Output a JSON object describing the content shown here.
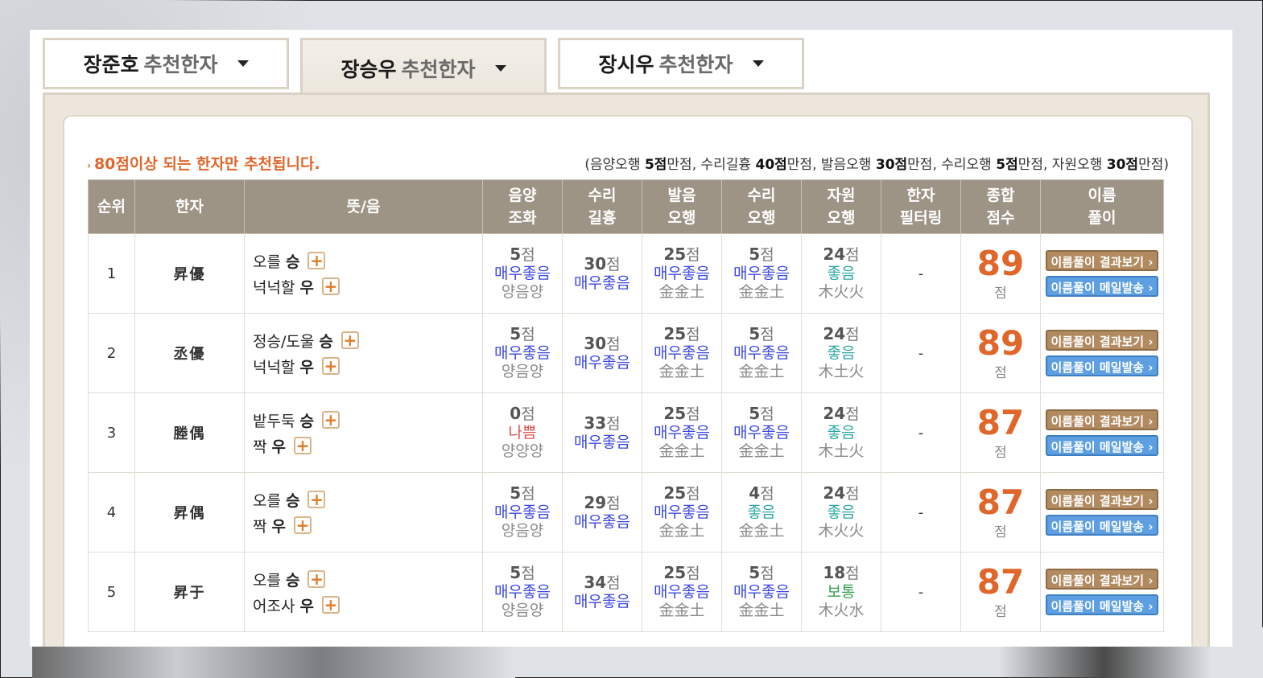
{
  "tabs": [
    {
      "name": "장준호",
      "suffix": "추천한자",
      "active": false
    },
    {
      "name": "장승우",
      "suffix": "추천한자",
      "active": true
    },
    {
      "name": "장시우",
      "suffix": "추천한자",
      "active": false
    }
  ],
  "notice": "80점이상 되는 한자만 추천됩니다.",
  "scoring": {
    "p1": "(음양오행 ",
    "v1": "5점",
    "p2": "만점, 수리길흉 ",
    "v2": "40점",
    "p3": "만점, 발음오행 ",
    "v3": "30점",
    "p4": "만점, 수리오행 ",
    "v4": "5점",
    "p5": "만점, 자원오행 ",
    "v5": "30점",
    "p6": "만점)"
  },
  "headers": {
    "rank": "순위",
    "hanja": "한자",
    "meaning": "뜻/음",
    "yinyang": [
      "음양",
      "조화"
    ],
    "suri": [
      "수리",
      "길흉"
    ],
    "pron": [
      "발음",
      "오행"
    ],
    "surielem": [
      "수리",
      "오행"
    ],
    "source": [
      "자원",
      "오행"
    ],
    "filter": [
      "한자",
      "필터링"
    ],
    "total": [
      "종합",
      "점수"
    ],
    "interp": [
      "이름",
      "풀이"
    ]
  },
  "unit": "점",
  "buttons": {
    "result": "이름풀이 결과보기",
    "mail": "이름풀이 메일발송"
  },
  "rows": [
    {
      "rank": "1",
      "hanja": "昇優",
      "m1": {
        "meaning": "오를",
        "sound": "승"
      },
      "m2": {
        "meaning": "넉넉할",
        "sound": "우"
      },
      "yy": {
        "score": "5",
        "grade": "매우좋음",
        "detail": "양음양"
      },
      "suri": {
        "score": "30",
        "grade": "매우좋음"
      },
      "pron": {
        "score": "25",
        "grade": "매우좋음",
        "detail": "金金土"
      },
      "se": {
        "score": "5",
        "grade": "매우좋음",
        "detail": "金金土"
      },
      "src": {
        "score": "24",
        "grade": "좋음",
        "detail": "木火火"
      },
      "filter": "-",
      "total": "89"
    },
    {
      "rank": "2",
      "hanja": "丞優",
      "m1": {
        "meaning": "정승/도울",
        "sound": "승"
      },
      "m2": {
        "meaning": "넉넉할",
        "sound": "우"
      },
      "yy": {
        "score": "5",
        "grade": "매우좋음",
        "detail": "양음양"
      },
      "suri": {
        "score": "30",
        "grade": "매우좋음"
      },
      "pron": {
        "score": "25",
        "grade": "매우좋음",
        "detail": "金金土"
      },
      "se": {
        "score": "5",
        "grade": "매우좋음",
        "detail": "金金土"
      },
      "src": {
        "score": "24",
        "grade": "좋음",
        "detail": "木土火"
      },
      "filter": "-",
      "total": "89"
    },
    {
      "rank": "3",
      "hanja": "塍偶",
      "m1": {
        "meaning": "밭두둑",
        "sound": "승"
      },
      "m2": {
        "meaning": "짝",
        "sound": "우"
      },
      "yy": {
        "score": "0",
        "grade": "나쁨",
        "detail": "양양양"
      },
      "suri": {
        "score": "33",
        "grade": "매우좋음"
      },
      "pron": {
        "score": "25",
        "grade": "매우좋음",
        "detail": "金金土"
      },
      "se": {
        "score": "5",
        "grade": "매우좋음",
        "detail": "金金土"
      },
      "src": {
        "score": "24",
        "grade": "좋음",
        "detail": "木土火"
      },
      "filter": "-",
      "total": "87"
    },
    {
      "rank": "4",
      "hanja": "昇偶",
      "m1": {
        "meaning": "오를",
        "sound": "승"
      },
      "m2": {
        "meaning": "짝",
        "sound": "우"
      },
      "yy": {
        "score": "5",
        "grade": "매우좋음",
        "detail": "양음양"
      },
      "suri": {
        "score": "29",
        "grade": "매우좋음"
      },
      "pron": {
        "score": "25",
        "grade": "매우좋음",
        "detail": "金金土"
      },
      "se": {
        "score": "4",
        "grade": "좋음",
        "detail": "金金土"
      },
      "src": {
        "score": "24",
        "grade": "좋음",
        "detail": "木火火"
      },
      "filter": "-",
      "total": "87"
    },
    {
      "rank": "5",
      "hanja": "昇于",
      "m1": {
        "meaning": "오를",
        "sound": "승"
      },
      "m2": {
        "meaning": "어조사",
        "sound": "우"
      },
      "yy": {
        "score": "5",
        "grade": "매우좋음",
        "detail": "양음양"
      },
      "suri": {
        "score": "34",
        "grade": "매우좋음"
      },
      "pron": {
        "score": "25",
        "grade": "매우좋음",
        "detail": "金金土"
      },
      "se": {
        "score": "5",
        "grade": "매우좋음",
        "detail": "金金土"
      },
      "src": {
        "score": "18",
        "grade": "보통",
        "detail": "木火水"
      },
      "filter": "-",
      "total": "87"
    }
  ],
  "colors": {
    "header_bg": "#9e9486",
    "total_orange": "#e0662a",
    "grade_very_good": "#3a48e0",
    "grade_good": "#2aa8a0",
    "grade_normal": "#35a050",
    "grade_bad": "#e05050",
    "btn_result": "#b28a60",
    "btn_mail": "#5d9fe0"
  }
}
